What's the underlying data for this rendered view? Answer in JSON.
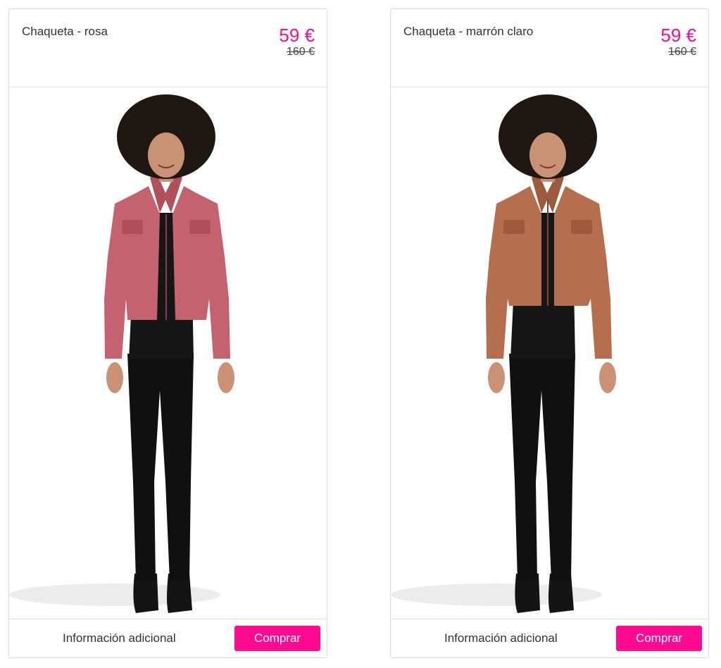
{
  "products": [
    {
      "title": "Chaqueta - rosa",
      "price": "59 €",
      "old_price": "160 €",
      "image": "model-pink-jacket",
      "jacket_color": "#c4636f",
      "info_label": "Información adicional",
      "buy_label": "Comprar"
    },
    {
      "title": "Chaqueta - marrón claro",
      "price": "59 €",
      "old_price": "160 €",
      "image": "model-light-brown-jacket",
      "jacket_color": "#b56f4f",
      "info_label": "Información adicional",
      "buy_label": "Comprar"
    }
  ],
  "colors": {
    "accent": "#ff0a90",
    "border": "#dcdcdc"
  }
}
